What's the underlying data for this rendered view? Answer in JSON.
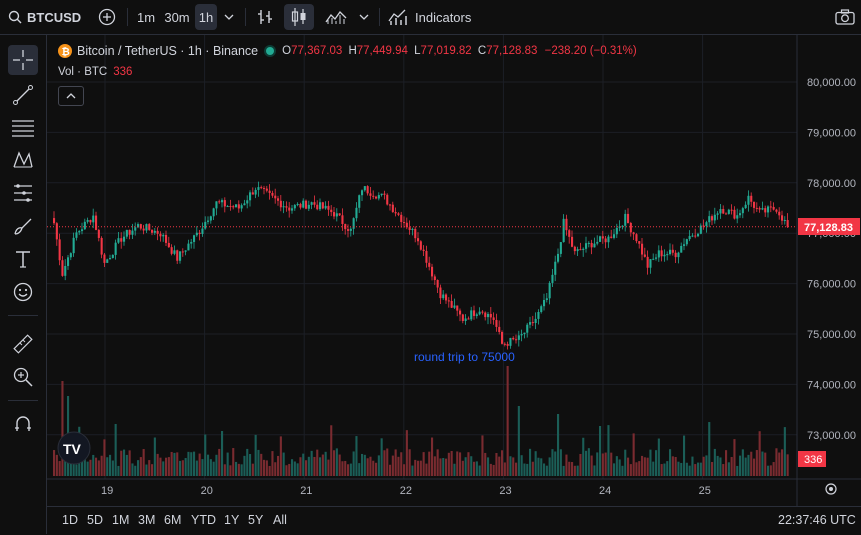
{
  "topbar": {
    "symbol": "BTCUSDT",
    "intervals": [
      "1m",
      "30m",
      "1h"
    ],
    "active_interval": "1h",
    "indicators_label": "Indicators"
  },
  "legend": {
    "title": "Bitcoin / TetherUS · 1h · Binance",
    "open_label": "O",
    "open": "77,367.03",
    "high_label": "H",
    "high": "77,449.94",
    "low_label": "L",
    "low": "77,019.82",
    "close_label": "C",
    "close": "77,128.83",
    "change": "−238.20 (−0.31%)",
    "vol_label": "Vol · BTC",
    "vol_value": "336"
  },
  "chart": {
    "price_ticks": [
      "80,000.00",
      "79,000.00",
      "78,000.00",
      "77,000.00",
      "76,000.00",
      "75,000.00",
      "74,000.00",
      "73,000.00"
    ],
    "current_price": "77,128.83",
    "current_volume": "336",
    "date_labels": [
      "19",
      "20",
      "21",
      "22",
      "23",
      "24",
      "25"
    ],
    "annotation": "round trip to 75000",
    "colors": {
      "up": "#22ab94",
      "down": "#f23645",
      "annotation": "#2962ff",
      "volume_up": "#1b5e57",
      "volume_down": "#7a2b30"
    }
  },
  "bottombar": {
    "ranges": [
      "1D",
      "5D",
      "1M",
      "3M",
      "6M",
      "YTD",
      "1Y",
      "5Y",
      "All"
    ],
    "clock": "22:37:46 UTC"
  },
  "tools": [
    "crosshair-icon",
    "trend-line-icon",
    "fib-lines-icon",
    "pattern-icon",
    "prediction-icon",
    "brush-icon",
    "text-icon",
    "emoji-icon",
    "ruler-icon",
    "zoom-icon",
    "magnet-icon"
  ]
}
